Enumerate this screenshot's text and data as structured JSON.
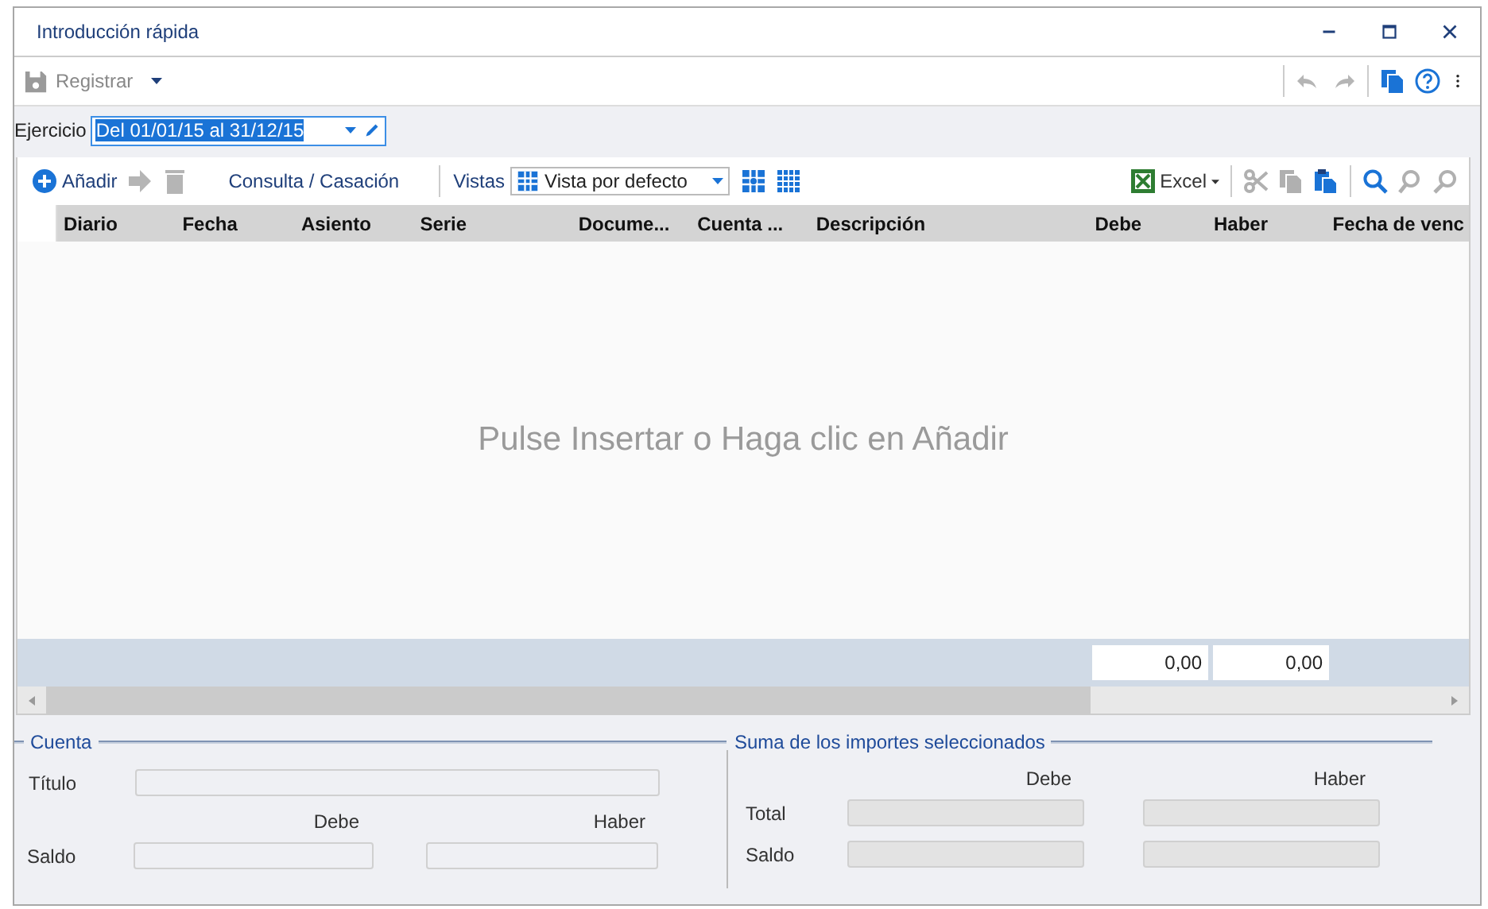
{
  "window": {
    "title": "Introducción rápida"
  },
  "toolbar": {
    "register": {
      "label": "Registrar",
      "disabled": true
    }
  },
  "period": {
    "label": "Ejercicio",
    "value": "Del 01/01/15 al 31/12/15"
  },
  "grid_toolbar": {
    "add": "Añadir",
    "query": "Consulta / Casación",
    "views_label": "Vistas",
    "view": "Vista por defecto",
    "excel": "Excel"
  },
  "table": {
    "columns": [
      "Diario",
      "Fecha",
      "Asiento",
      "Serie",
      "Docume...",
      "Cuenta ...",
      "Descripción",
      "Debe",
      "Haber",
      "Fecha de venc"
    ],
    "empty_message": "Pulse Insertar o Haga clic en Añadir",
    "totals": [
      "0,00",
      "0,00"
    ]
  },
  "account": {
    "title": "Cuenta",
    "title_label": "Título",
    "debit_header": "Debe",
    "credit_header": "Haber",
    "balance_label": "Saldo",
    "fields": [
      {
        "disabled": false
      },
      {
        "disabled": false
      },
      {
        "disabled": false
      }
    ]
  },
  "selection_sum": {
    "title": "Suma de los importes seleccionados",
    "debit_header": "Debe",
    "credit_header": "Haber",
    "total_label": "Total",
    "balance_label": "Saldo",
    "fields": [
      {
        "disabled": true
      },
      {
        "disabled": true
      },
      {
        "disabled": true
      },
      {
        "disabled": true
      }
    ]
  }
}
